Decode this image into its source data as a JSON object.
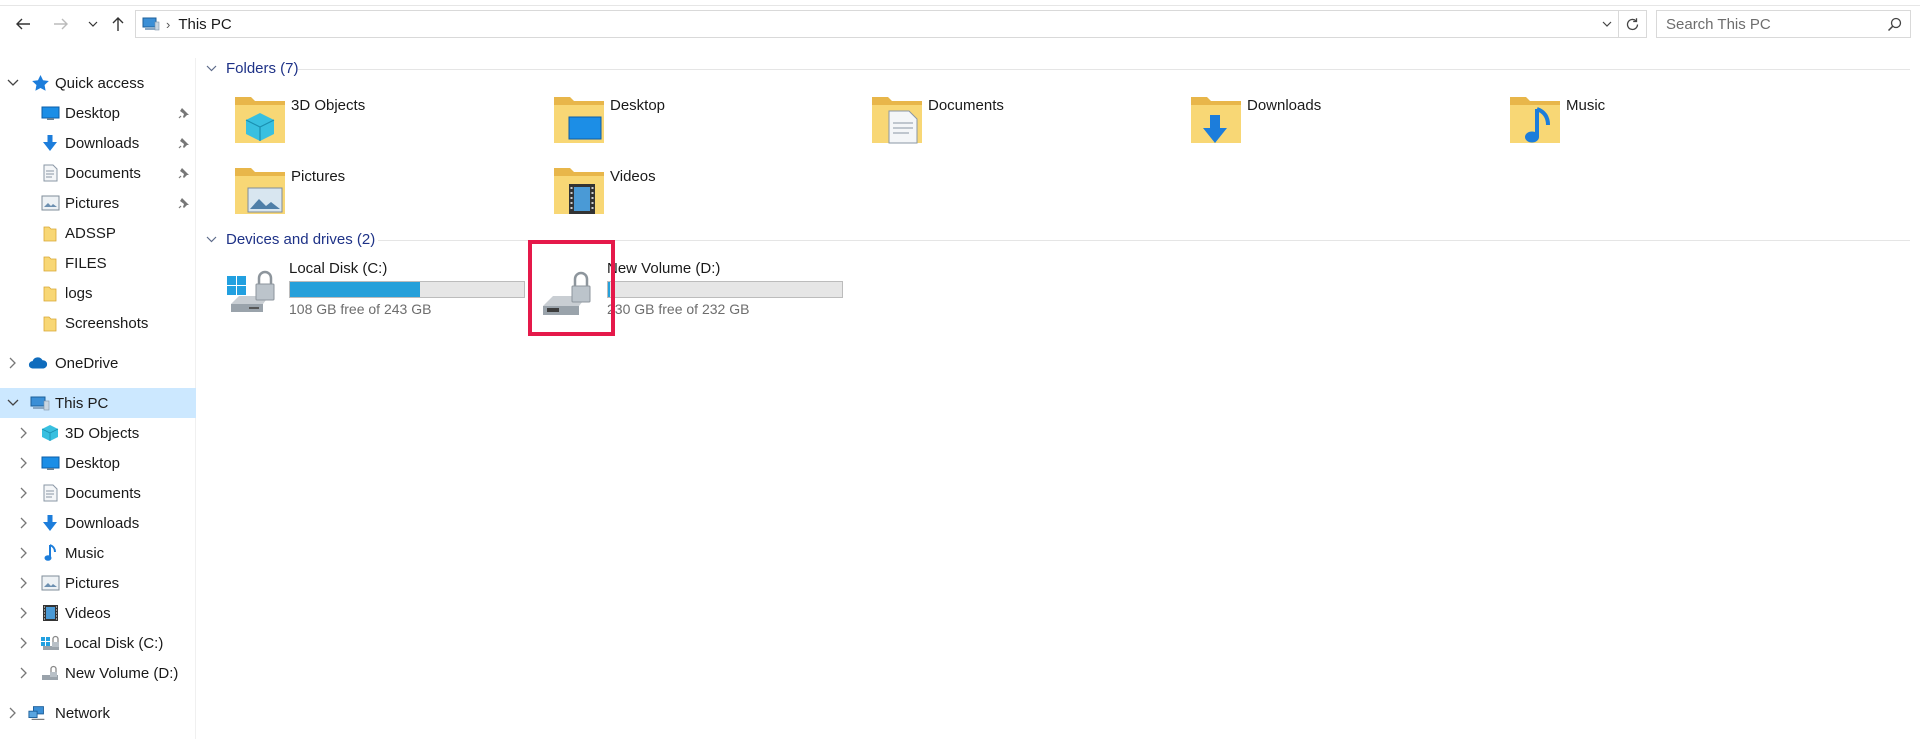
{
  "toolbar": {
    "back_icon": "arrow-left-icon",
    "forward_icon": "arrow-right-icon",
    "recent_icon": "chevron-down-icon",
    "up_icon": "arrow-up-icon"
  },
  "address": {
    "crumbs": [
      "This PC"
    ],
    "refresh_icon": "refresh-icon"
  },
  "search": {
    "placeholder": "Search This PC"
  },
  "sidebar": {
    "quick_access": {
      "label": "Quick access",
      "items": [
        {
          "label": "Desktop",
          "icon": "desktop-icon",
          "pinned": true
        },
        {
          "label": "Downloads",
          "icon": "downloads-icon",
          "pinned": true
        },
        {
          "label": "Documents",
          "icon": "documents-icon",
          "pinned": true
        },
        {
          "label": "Pictures",
          "icon": "pictures-icon",
          "pinned": true
        },
        {
          "label": "ADSSP",
          "icon": "folder-icon",
          "pinned": false
        },
        {
          "label": "FILES",
          "icon": "folder-icon",
          "pinned": false
        },
        {
          "label": "logs",
          "icon": "folder-icon",
          "pinned": false
        },
        {
          "label": "Screenshots",
          "icon": "folder-icon",
          "pinned": false
        }
      ]
    },
    "onedrive": {
      "label": "OneDrive"
    },
    "this_pc": {
      "label": "This PC",
      "items": [
        {
          "label": "3D Objects",
          "icon": "3d-objects-icon"
        },
        {
          "label": "Desktop",
          "icon": "desktop-icon"
        },
        {
          "label": "Documents",
          "icon": "documents-icon"
        },
        {
          "label": "Downloads",
          "icon": "downloads-icon"
        },
        {
          "label": "Music",
          "icon": "music-icon"
        },
        {
          "label": "Pictures",
          "icon": "pictures-icon"
        },
        {
          "label": "Videos",
          "icon": "videos-icon"
        },
        {
          "label": "Local Disk (C:)",
          "icon": "local-disk-icon"
        },
        {
          "label": "New Volume (D:)",
          "icon": "drive-icon"
        }
      ]
    },
    "network": {
      "label": "Network"
    }
  },
  "content": {
    "folders_header": "Folders (7)",
    "folders": [
      {
        "label": "3D Objects",
        "icon": "3d-objects-folder-icon"
      },
      {
        "label": "Desktop",
        "icon": "desktop-folder-icon"
      },
      {
        "label": "Documents",
        "icon": "documents-folder-icon"
      },
      {
        "label": "Downloads",
        "icon": "downloads-folder-icon"
      },
      {
        "label": "Music",
        "icon": "music-folder-icon"
      },
      {
        "label": "Pictures",
        "icon": "pictures-folder-icon"
      },
      {
        "label": "Videos",
        "icon": "videos-folder-icon"
      }
    ],
    "drives_header": "Devices and drives (2)",
    "drives": [
      {
        "label": "Local Disk (C:)",
        "free_text": "108 GB free of 243 GB",
        "used_fraction": 0.556,
        "icon": "windows-drive-locked-icon"
      },
      {
        "label": "New Volume (D:)",
        "free_text": "230 GB free of 232 GB",
        "used_fraction": 0.009,
        "icon": "drive-locked-icon"
      }
    ]
  },
  "colors": {
    "selected_bg": "#cce8ff",
    "group_header": "#1e3287",
    "usage_bar": "#26a0da",
    "highlight": "#e5194a",
    "folder_yellow": "#f8d775"
  }
}
